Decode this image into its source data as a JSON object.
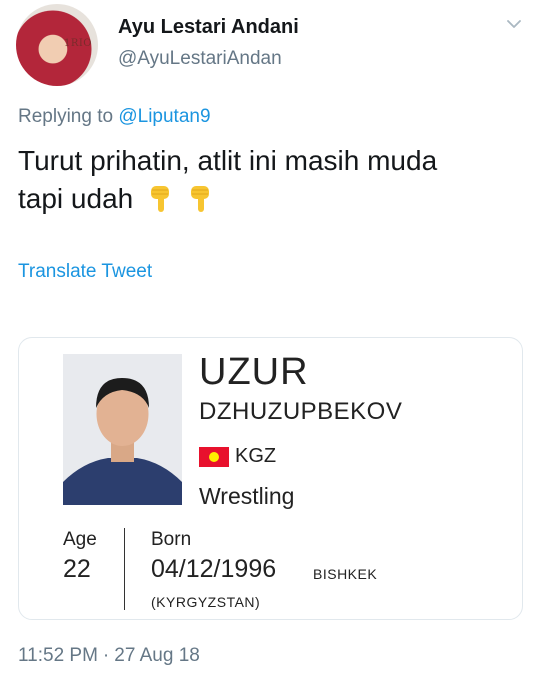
{
  "author": {
    "name": "Ayu Lestari Andani",
    "handle": "@AyuLestariAndan",
    "avatar_tag": "1RIO"
  },
  "reply": {
    "prefix": "Replying to ",
    "mention": "@Liputan9"
  },
  "tweet": {
    "text_line1": "Turut prihatin, atlit ini masih muda",
    "text_line2": "tapi udah",
    "emojis": [
      "backhand-index-pointing-down-icon",
      "backhand-index-pointing-down-icon"
    ]
  },
  "translate_label": "Translate Tweet",
  "card": {
    "first_name": "UZUR",
    "last_name": "DZHUZUPBEKOV",
    "country_code": "KGZ",
    "flag_colors": {
      "field": "#e8112d",
      "sun": "#ffef00"
    },
    "sport": "Wrestling",
    "age_label": "Age",
    "age_value": "22",
    "born_label": "Born",
    "born_date": "04/12/1996",
    "born_city": "BISHKEK",
    "born_country": "(KYRGYZSTAN)"
  },
  "meta": {
    "time": "11:52 PM",
    "separator": "·",
    "date": "27 Aug 18"
  },
  "colors": {
    "link": "#1b95e0",
    "secondary_text": "#657786",
    "primary_text": "#14171a",
    "card_border": "#e1e8ed"
  }
}
